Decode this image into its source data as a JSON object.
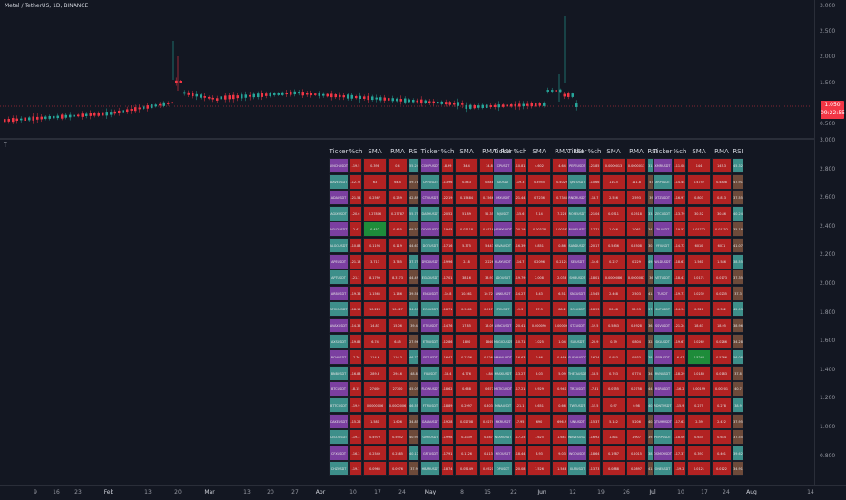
{
  "header": {
    "title": "Metal / TetherUS, 1D, BINANCE",
    "indicator_label": "T"
  },
  "price_axis": {
    "top_ticks": [
      "3.000",
      "2.500",
      "2.000",
      "1.500",
      "1.000",
      "0.500"
    ],
    "price_tag": "1.050",
    "countdown": "09:22:55"
  },
  "indicator_axis": {
    "ticks": [
      "3.000",
      "2.800",
      "2.600",
      "2.400",
      "2.200",
      "2.000",
      "1.800",
      "1.600",
      "1.400",
      "1.200",
      "1.000",
      "0.800"
    ]
  },
  "time_axis": {
    "labels": [
      "9",
      "16",
      "23",
      "Feb",
      "13",
      "20",
      "Mar",
      "13",
      "20",
      "27",
      "Apr",
      "10",
      "17",
      "24",
      "May",
      "8",
      "15",
      "22",
      "Jun",
      "12",
      "19",
      "26",
      "Jul",
      "10",
      "17",
      "24",
      "Aug",
      "14"
    ]
  },
  "colors": {
    "bg": "#131722",
    "up": "#26a69a",
    "down": "#f23645",
    "red_cell": "#b22222",
    "purple_cell": "#7b3fa0",
    "teal_cell": "#3d8f8a",
    "green_cell": "#1e8c3a",
    "brown_cell": "#6d4a3a"
  },
  "table": {
    "headers": [
      "Ticker",
      "%ch",
      "SMA",
      "RMA",
      "RSI"
    ],
    "columns": [
      {
        "rows": [
          [
            "1INCHUSDT",
            "-19.5",
            "0.398",
            "0.4",
            "55.24"
          ],
          [
            "AAVEUSDT",
            "-12.77",
            "63",
            "64.4",
            "59.78"
          ],
          [
            "ADAUSDT",
            "-21.54",
            "0.2567",
            "0.259",
            "42.89"
          ],
          [
            "AGIXUSDT",
            "-20.6",
            "0.27806",
            "0.27787",
            "55.75"
          ],
          [
            "AGLDUSDT",
            "-2.41",
            "0.452",
            "0.455",
            "69.53"
          ],
          [
            "ALGOUSDT",
            "-10.83",
            "0.1196",
            "0.119",
            "44.63"
          ],
          [
            "APEUSDT",
            "-21.13",
            "3.713",
            "3.765",
            "37.75"
          ],
          [
            "APTUSDT",
            "-21.1",
            "8.1799",
            "8.3173",
            "44.49"
          ],
          [
            "ARBUSDT",
            "-19.36",
            "1.1565",
            "1.166",
            "39.58"
          ],
          [
            "ATOMUSDT",
            "-18.15",
            "10.223",
            "10.427",
            "34.07"
          ],
          [
            "AVAXUSDT",
            "-14.35",
            "14.83",
            "15.06",
            "39.4"
          ],
          [
            "AXSUSDT",
            "-19.85",
            "6.74",
            "6.85",
            "27.96"
          ],
          [
            "BCHUSDT",
            "-7.76",
            "114.6",
            "116.3",
            "46.72"
          ],
          [
            "BNBUSDT",
            "-16.83",
            "289.8",
            "294.6",
            "48.8"
          ],
          [
            "BTCUSDT",
            "-8.15",
            "27400",
            "27700",
            "45.05"
          ],
          [
            "BTTCUSDT",
            "-19.9",
            "0.0000006",
            "0.0000006",
            "46.55"
          ],
          [
            "CAKEUSDT",
            "-15.26",
            "1.581",
            "1.606",
            "34.85"
          ],
          [
            "CELOUSDT",
            "-19.3",
            "0.4979",
            "0.5052",
            "40.95"
          ],
          [
            "CFXUSDT",
            "-16.3",
            "0.2549",
            "0.2585",
            "40.17"
          ],
          [
            "CHZUSDT",
            "-19.1",
            "0.0965",
            "0.0976",
            "37.9"
          ]
        ]
      },
      {
        "rows": [
          [
            "COMPUSDT",
            "-8.99",
            "34.4",
            "34.8",
            "35.38"
          ],
          [
            "CRVUSDT",
            "-13.96",
            "0.843",
            "0.848",
            "55.24"
          ],
          [
            "CTSIUSDT",
            "-22.19",
            "0.15484",
            "0.15663",
            "45.5"
          ],
          [
            "DASHUSDT",
            "-20.52",
            "51.89",
            "52.35",
            "42.69"
          ],
          [
            "DOGEUSDT",
            "-19.45",
            "0.07118",
            "0.07199",
            "41.38"
          ],
          [
            "DOTUSDT",
            "-17.16",
            "5.375",
            "5.443",
            "36.19"
          ],
          [
            "DYDXUSDT",
            "-19.96",
            "2.18",
            "2.226",
            "29.49"
          ],
          [
            "EGLDUSDT",
            "-17.01",
            "38.16",
            "38.93",
            "41.58"
          ],
          [
            "ENSUSDT",
            "-14.8",
            "10.561",
            "10.729",
            "33.34"
          ],
          [
            "EOSUSDT",
            "-18.71",
            "0.9061",
            "0.9174",
            "38.18"
          ],
          [
            "ETCUSDT",
            "-14.76",
            "17.85",
            "18.09",
            "39.96"
          ],
          [
            "ETHUSDT",
            "-12.86",
            "1820",
            "1840",
            "43.87"
          ],
          [
            "FETUSDT",
            "-16.47",
            "0.2236",
            "0.2268",
            "40.24"
          ],
          [
            "FILUSDT",
            "-18.4",
            "4.776",
            "4.84",
            "36.66"
          ],
          [
            "FLOWUSDT",
            "-18.62",
            "0.668",
            "0.677",
            "41.02"
          ],
          [
            "FTMUSDT",
            "-18.89",
            "0.2997",
            "0.3033",
            "37.16"
          ],
          [
            "GALAUSDT",
            "-19.28",
            "0.02708",
            "0.02742",
            "34.8"
          ],
          [
            "GMTUSDT",
            "-19.98",
            "0.2839",
            "0.2877",
            "31.51"
          ],
          [
            "GRTUSDT",
            "-17.91",
            "0.1126",
            "0.1137",
            "36.47"
          ],
          [
            "HBARUSDT",
            "-18.74",
            "0.05149",
            "0.05216",
            "39.01"
          ]
        ]
      },
      {
        "rows": [
          [
            "ICPUSDT",
            "-10.81",
            "4.602",
            "4.64",
            "38.93"
          ],
          [
            "IDUSDT",
            "-19.3",
            "0.3955",
            "0.4029",
            "31.9"
          ],
          [
            "IMXUSDT",
            "-21.44",
            "0.7236",
            "0.7346",
            "31.51"
          ],
          [
            "INJUSDT",
            "-15.6",
            "7.14",
            "7.228",
            "48.46"
          ],
          [
            "JASMYUSDT",
            "-20.19",
            "0.00378",
            "0.00383",
            "33.5"
          ],
          [
            "KAVAUSDT",
            "-16.39",
            "0.851",
            "0.86",
            "35.81"
          ],
          [
            "KLAYUSDT",
            "-14.7",
            "0.2096",
            "0.2121",
            "33.04"
          ],
          [
            "LDOUSDT",
            "-19.79",
            "2.008",
            "2.038",
            "42.47"
          ],
          [
            "LINKUSDT",
            "-14.27",
            "6.43",
            "6.51",
            "41.21"
          ],
          [
            "LTCUSDT",
            "-9.3",
            "87.3",
            "88.2",
            "40.56"
          ],
          [
            "LUNCUSDT",
            "-20.41",
            "0.000094",
            "0.000095",
            "27.8"
          ],
          [
            "MAGICUSDT",
            "-10.71",
            "1.025",
            "1.04",
            "48.12"
          ],
          [
            "MANAUSDT",
            "-16.63",
            "0.46",
            "0.466",
            "35.8"
          ],
          [
            "MASKUSDT",
            "-13.27",
            "5.03",
            "5.09",
            "53.35"
          ],
          [
            "MATICUSDT",
            "-17.21",
            "0.929",
            "0.941",
            "36.71"
          ],
          [
            "MINAUSDT",
            "-21.1",
            "0.651",
            "0.66",
            "34.45"
          ],
          [
            "MKRUSDT",
            "-7.95",
            "690",
            "696.9",
            "50.94"
          ],
          [
            "NEARUSDT",
            "-17.25",
            "1.625",
            "1.643",
            "36.8"
          ],
          [
            "NEOUSDT",
            "-18.44",
            "8.93",
            "9.03",
            "36.72"
          ],
          [
            "OPUSDT",
            "-20.08",
            "1.526",
            "1.548",
            "36.45"
          ]
        ]
      },
      {
        "rows": [
          [
            "PEPEUSDT",
            "-21.85",
            "0.0000013",
            "0.0000013",
            "31.05"
          ],
          [
            "QNTUSDT",
            "-10.66",
            "110.5",
            "111.8",
            "47.6"
          ],
          [
            "RNDRUSDT",
            "-18.7",
            "2.556",
            "2.593",
            "39.5"
          ],
          [
            "ROSEUSDT",
            "-21.04",
            "0.0511",
            "0.0518",
            "33.87"
          ],
          [
            "RUNEUSDT",
            "-17.71",
            "1.046",
            "1.061",
            "34.91"
          ],
          [
            "SANDUSDT",
            "-20.17",
            "0.5436",
            "0.5508",
            "30.12"
          ],
          [
            "SEIUSDT",
            "-14.6",
            "0.227",
            "0.229",
            "49.17"
          ],
          [
            "SHIBUSDT",
            "-18.01",
            "0.0000086",
            "0.0000087",
            "36.5"
          ],
          [
            "SNXUSDT",
            "-15.45",
            "2.468",
            "2.503",
            "41.74"
          ],
          [
            "SOLUSDT",
            "-18.93",
            "20.68",
            "20.93",
            "37.17"
          ],
          [
            "STXUSDT",
            "-19.5",
            "0.5843",
            "0.5928",
            "36.79"
          ],
          [
            "SUIUSDT",
            "-20.9",
            "0.79",
            "0.804",
            "32.24"
          ],
          [
            "SUSHIUSDT",
            "-16.24",
            "0.923",
            "0.933",
            "38.51"
          ],
          [
            "THETAUSDT",
            "-18.5",
            "0.763",
            "0.774",
            "34.25"
          ],
          [
            "TRXUSDT",
            "-7.31",
            "0.0755",
            "0.0758",
            "44.94"
          ],
          [
            "TWTUSDT",
            "-15.5",
            "0.97",
            "0.98",
            "40.16"
          ],
          [
            "UNIUSDT",
            "-15.37",
            "5.142",
            "5.206",
            "40.71"
          ],
          [
            "WAVESUSDT",
            "-16.92",
            "1.881",
            "1.907",
            "39.96"
          ],
          [
            "WOOUSDT",
            "-18.64",
            "0.1987",
            "0.2015",
            "38.57"
          ],
          [
            "XLMUSDT",
            "-13.73",
            "0.0888",
            "0.0897",
            "41.35"
          ]
        ]
      },
      {
        "rows": [
          [
            "XMRUSDT",
            "-11.08",
            "144",
            "145.3",
            "45.32"
          ],
          [
            "XRPUSDT",
            "-14.44",
            "0.4752",
            "0.4808",
            "47.91"
          ],
          [
            "XTZUSDT",
            "-16.97",
            "0.803",
            "0.813",
            "37.55"
          ],
          [
            "ZECUSDT",
            "-13.79",
            "30.52",
            "30.86",
            "40.24"
          ],
          [
            "ZILUSDT",
            "-19.52",
            "0.01732",
            "0.01752",
            "35.18"
          ],
          [
            "YFIUSDT",
            "-14.72",
            "6010",
            "6071",
            "41.07"
          ],
          [
            "WLDUSDT",
            "-18.61",
            "1.561",
            "1.586",
            "38.55"
          ],
          [
            "VETUSDT",
            "-18.41",
            "0.0171",
            "0.0173",
            "37.35"
          ],
          [
            "TUSDT",
            "-19.71",
            "0.0232",
            "0.0235",
            "37.3"
          ],
          [
            "SXPUSDT",
            "-14.94",
            "0.328",
            "0.332",
            "42.03"
          ],
          [
            "SSVUSDT",
            "-21.24",
            "18.63",
            "18.95",
            "38.96"
          ],
          [
            "SKLUSDT",
            "-19.67",
            "0.0262",
            "0.0266",
            "34.28"
          ],
          [
            "SFPUSDT",
            "-6.47",
            "0.5244",
            "0.5266",
            "56.08"
          ],
          [
            "RVNUSDT",
            "-18.29",
            "0.0180",
            "0.0183",
            "37.8"
          ],
          [
            "RSRUSDT",
            "-16.2",
            "0.00199",
            "0.00201",
            "40.7"
          ],
          [
            "RDNTUSDT",
            "-15.9",
            "0.275",
            "0.278",
            "38.9"
          ],
          [
            "QTUMUSDT",
            "-17.63",
            "2.39",
            "2.422",
            "37.95"
          ],
          [
            "PERPUSDT",
            "-18.06",
            "0.635",
            "0.644",
            "37.55"
          ],
          [
            "OSMOUSDT",
            "-17.37",
            "0.397",
            "0.401",
            "39.62"
          ],
          [
            "ONEUSDT",
            "-19.2",
            "0.0121",
            "0.0122",
            "34.91"
          ]
        ]
      }
    ]
  }
}
